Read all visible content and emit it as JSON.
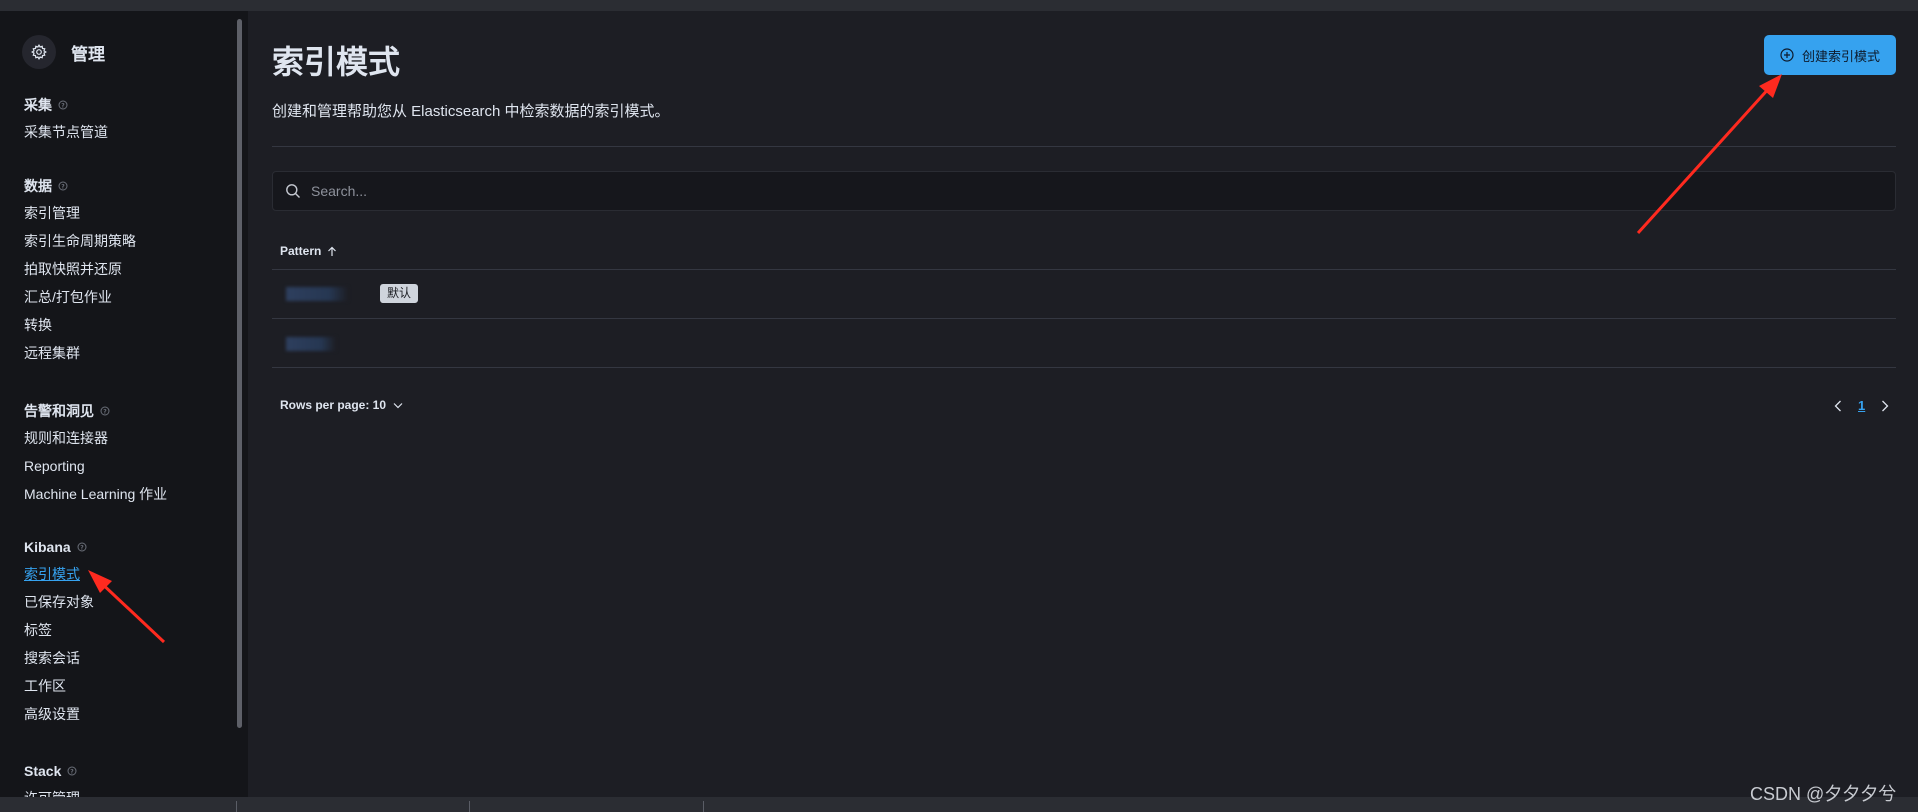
{
  "sidebar": {
    "title": "管理",
    "groups": [
      {
        "title": "采集",
        "items": [
          "采集节点管道"
        ]
      },
      {
        "title": "数据",
        "items": [
          "索引管理",
          "索引生命周期策略",
          "拍取快照并还原",
          "汇总/打包作业",
          "转换",
          "远程集群"
        ]
      },
      {
        "title": "告警和洞见",
        "items": [
          "规则和连接器",
          "Reporting",
          "Machine Learning 作业"
        ]
      },
      {
        "title": "Kibana",
        "items": [
          "索引模式",
          "已保存对象",
          "标签",
          "搜索会话",
          "工作区",
          "高级设置"
        ],
        "active_item": "索引模式"
      },
      {
        "title": "Stack",
        "items": [
          "许可管理"
        ]
      }
    ]
  },
  "main": {
    "title": "索引模式",
    "description": "创建和管理帮助您从 Elasticsearch 中检索数据的索引模式。",
    "create_button": "创建索引模式",
    "search_placeholder": "Search...",
    "table": {
      "column_header": "Pattern",
      "default_badge": "默认"
    },
    "rows_per_page": "Rows per page: 10",
    "current_page": "1"
  },
  "watermark": "CSDN @夕夕夕兮",
  "colors": {
    "accent": "#36a2ef",
    "annotation_arrow": "#ff2a1f"
  }
}
